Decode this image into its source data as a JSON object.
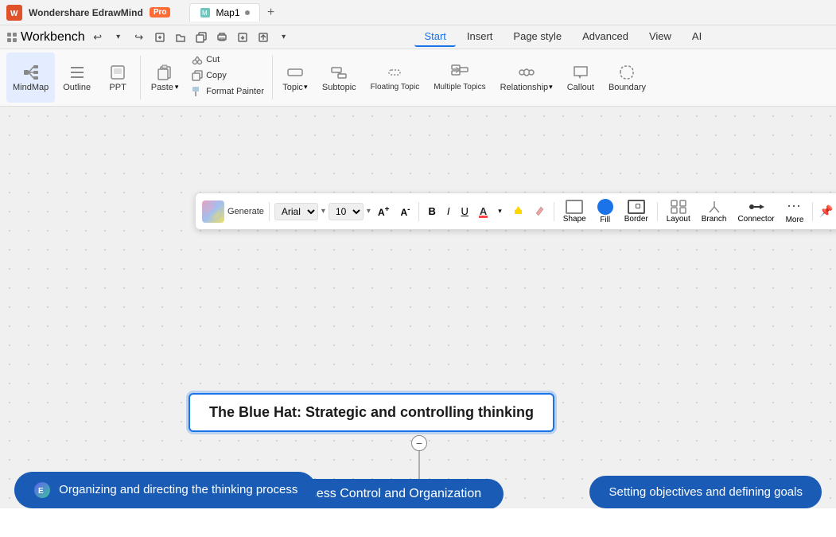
{
  "app": {
    "name": "Wondershare EdrawMind",
    "badge": "Pro",
    "tab_name": "Map1",
    "logo_color": "#e0522a"
  },
  "titlebar": {
    "workbench_label": "Workbench",
    "add_tab_icon": "+"
  },
  "menubar": {
    "undo_icon": "↩",
    "redo_icon": "↪",
    "items": [
      "Workbench"
    ],
    "nav_tabs": [
      {
        "label": "Start",
        "active": true
      },
      {
        "label": "Insert",
        "active": false
      },
      {
        "label": "Page style",
        "active": false
      },
      {
        "label": "Advanced",
        "active": false
      },
      {
        "label": "View",
        "active": false
      },
      {
        "label": "AI",
        "active": false
      }
    ]
  },
  "ribbon": {
    "left_group": [
      {
        "label": "MindMap",
        "icon": "⊞"
      },
      {
        "label": "Outline",
        "icon": "☰"
      },
      {
        "label": "PPT",
        "icon": "▣"
      }
    ],
    "tools": [
      {
        "label": "Paste",
        "icon": "📋"
      },
      {
        "label": "Cut",
        "icon": "✂"
      },
      {
        "label": "Copy",
        "icon": "⿻"
      },
      {
        "label": "Format Painter",
        "icon": "🖌"
      }
    ],
    "insert_tools": [
      {
        "label": "Topic",
        "icon": "⬜"
      },
      {
        "label": "Subtopic",
        "icon": "⬜"
      },
      {
        "label": "Floating Topic",
        "icon": "⬜"
      },
      {
        "label": "Multiple Topics",
        "icon": "⬜"
      },
      {
        "label": "Relationship",
        "icon": "⬡"
      },
      {
        "label": "Callout",
        "icon": "💬"
      },
      {
        "label": "Boundary",
        "icon": "⬚"
      }
    ]
  },
  "floating_toolbar": {
    "font_name": "Arial",
    "font_size": "10",
    "increase_icon": "A+",
    "decrease_icon": "A-",
    "bold_label": "B",
    "italic_label": "I",
    "underline_label": "U",
    "font_color_label": "A",
    "highlight_icon": "🖊",
    "format_items": [
      {
        "label": "Shape",
        "icon": "⬜"
      },
      {
        "label": "Fill",
        "icon": "●"
      },
      {
        "label": "Border",
        "icon": "⬚"
      },
      {
        "label": "Layout",
        "icon": "⠿"
      },
      {
        "label": "Branch",
        "icon": "⎇"
      },
      {
        "label": "Connector",
        "icon": "—"
      },
      {
        "label": "More",
        "icon": "⋯"
      }
    ]
  },
  "canvas": {
    "main_topic": "The Blue Hat: Strategic and controlling thinking",
    "subtopic": "Process Control and Organization",
    "bottom_nodes": [
      "Organizing and directing the thinking process",
      "Setting objectives and defining goals"
    ],
    "collapse_icon": "−"
  },
  "statusbar": {
    "text1": "Organizing and directing the thinking process",
    "text2": "Setting objectives and defining goals"
  }
}
